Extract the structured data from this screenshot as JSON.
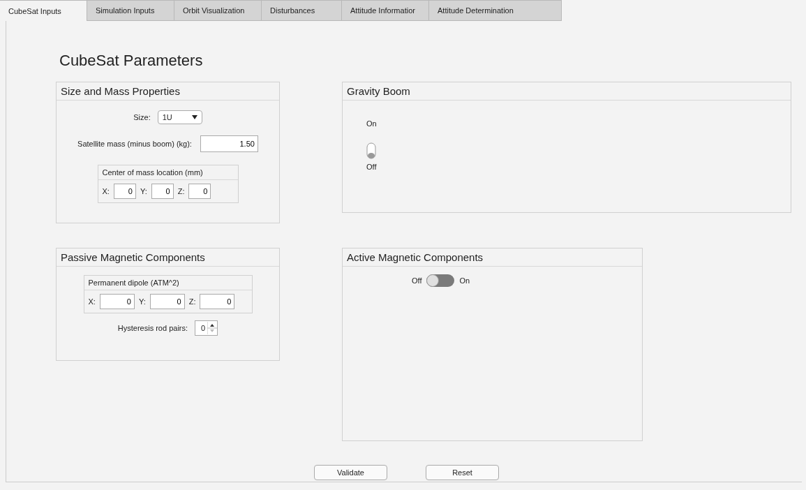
{
  "tabs": [
    {
      "label": "CubeSat Inputs",
      "selected": true
    },
    {
      "label": "Simulation Inputs",
      "selected": false
    },
    {
      "label": "Orbit Visualization",
      "selected": false
    },
    {
      "label": "Disturbances",
      "selected": false
    },
    {
      "label": "Attitude Informatior",
      "selected": false
    },
    {
      "label": "Attitude Determination",
      "selected": false
    }
  ],
  "title": "CubeSat Parameters",
  "size_mass": {
    "title": "Size and Mass Properties",
    "size_label": "Size:",
    "size_value": "1U",
    "mass_label": "Satellite mass (minus boom) (kg):",
    "mass_value": "1.50",
    "center_of_mass": {
      "title": "Center of mass location (mm)",
      "fields": [
        {
          "label": "X:",
          "value": "0"
        },
        {
          "label": "Y:",
          "value": "0"
        },
        {
          "label": "Z:",
          "value": "0"
        }
      ]
    }
  },
  "gravity_boom": {
    "title": "Gravity Boom",
    "on_label": "On",
    "off_label": "Off",
    "on": false
  },
  "passive": {
    "title": "Passive Magnetic Components",
    "dipole": {
      "title": "Permanent dipole (ATM^2)",
      "fields": [
        {
          "label": "X:",
          "value": "0"
        },
        {
          "label": "Y:",
          "value": "0"
        },
        {
          "label": "Z:",
          "value": "0"
        }
      ]
    },
    "rod_label": "Hysteresis rod pairs:",
    "rod_value": "0"
  },
  "active": {
    "title": "Active Magnetic Components",
    "off_label": "Off",
    "on_label": "On",
    "on": false
  },
  "buttons": [
    "Validate",
    "Reset"
  ]
}
